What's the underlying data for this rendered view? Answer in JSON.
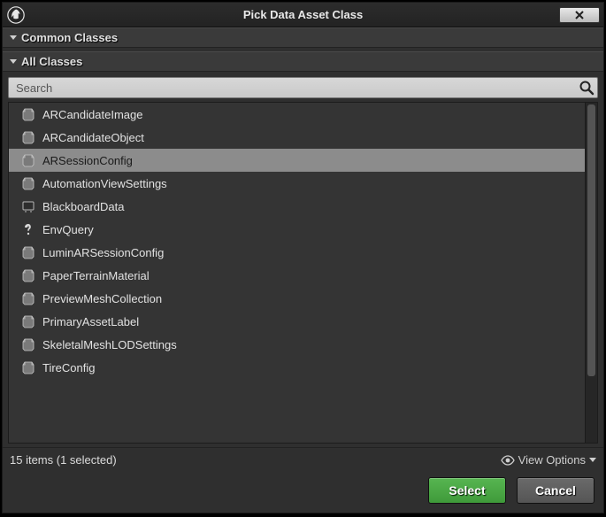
{
  "window": {
    "title": "Pick Data Asset Class"
  },
  "sections": {
    "common": "Common Classes",
    "all": "All Classes"
  },
  "search": {
    "placeholder": "Search"
  },
  "classes": [
    {
      "label": "ARCandidateImage",
      "icon": "data-asset",
      "selected": false
    },
    {
      "label": "ARCandidateObject",
      "icon": "data-asset",
      "selected": false
    },
    {
      "label": "ARSessionConfig",
      "icon": "data-asset",
      "selected": true
    },
    {
      "label": "AutomationViewSettings",
      "icon": "data-asset",
      "selected": false
    },
    {
      "label": "BlackboardData",
      "icon": "blackboard",
      "selected": false
    },
    {
      "label": "EnvQuery",
      "icon": "env-query",
      "selected": false
    },
    {
      "label": "LuminARSessionConfig",
      "icon": "data-asset",
      "selected": false
    },
    {
      "label": "PaperTerrainMaterial",
      "icon": "data-asset",
      "selected": false
    },
    {
      "label": "PreviewMeshCollection",
      "icon": "data-asset",
      "selected": false
    },
    {
      "label": "PrimaryAssetLabel",
      "icon": "data-asset",
      "selected": false
    },
    {
      "label": "SkeletalMeshLODSettings",
      "icon": "data-asset",
      "selected": false
    },
    {
      "label": "TireConfig",
      "icon": "data-asset",
      "selected": false
    }
  ],
  "status": {
    "text": "15 items (1 selected)",
    "view_options_label": "View Options"
  },
  "buttons": {
    "select": "Select",
    "cancel": "Cancel"
  }
}
